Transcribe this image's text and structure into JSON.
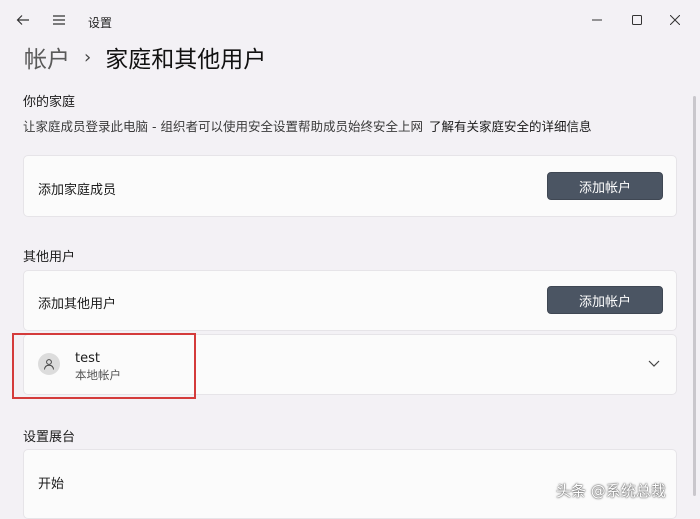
{
  "window": {
    "title": "设置"
  },
  "breadcrumb": {
    "parent": "帐户",
    "separator": "›",
    "current": "家庭和其他用户"
  },
  "family": {
    "heading": "你的家庭",
    "description": "让家庭成员登录此电脑 - 组织者可以使用安全设置帮助成员始终安全上网",
    "link": "了解有关家庭安全的详细信息",
    "add_label": "添加家庭成员",
    "add_button": "添加帐户"
  },
  "other_users": {
    "heading": "其他用户",
    "add_label": "添加其他用户",
    "add_button": "添加帐户",
    "user": {
      "name": "test",
      "type": "本地帐户"
    }
  },
  "kiosk": {
    "heading": "设置展台",
    "item_label": "开始"
  },
  "watermark": "头条 @系统总裁",
  "colors": {
    "button_bg": "#4b5563",
    "highlight_border": "#d43b3b",
    "window_bg": "#f3f1f5"
  }
}
